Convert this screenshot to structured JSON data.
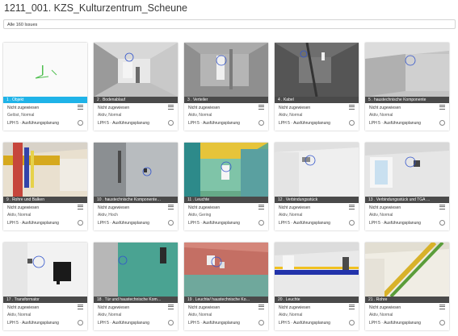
{
  "page": {
    "title": "1211_001. KZS_Kulturzentrum_Scheune",
    "filter_label": "Alle 160 Issues"
  },
  "issues": [
    {
      "label": "1 . Objekt",
      "assignee": "Nicht zugewiesen",
      "status": "Gelöst, Normal",
      "phase": "LPH 5 · Ausführungsplanung",
      "active": true,
      "thumb": "white-green"
    },
    {
      "label": "2 . Bodenablauf",
      "assignee": "Nicht zugewiesen",
      "status": "Aktiv, Normal",
      "phase": "LPH 5 · Ausführungsplanung",
      "active": false,
      "thumb": "corridor"
    },
    {
      "label": "3 . Verteiler",
      "assignee": "Nicht zugewiesen",
      "status": "Aktiv, Normal",
      "phase": "LPH 5 · Ausführungsplanung",
      "active": false,
      "thumb": "grey-room"
    },
    {
      "label": "4 . Kabel",
      "assignee": "Nicht zugewiesen",
      "status": "Aktiv, Normal",
      "phase": "LPH 5 · Ausführungsplanung",
      "active": false,
      "thumb": "dark-room"
    },
    {
      "label": "5 . haustechnische Komponente",
      "assignee": "Nicht zugewiesen",
      "status": "Aktiv, Normal",
      "phase": "LPH 5 · Ausführungsplanung",
      "active": false,
      "thumb": "grey-corner"
    },
    {
      "label": "9 . Rohre und Balken",
      "assignee": "Nicht zugewiesen",
      "status": "Aktiv, Normal",
      "phase": "LPH 5 · Ausführungsplanung",
      "active": false,
      "thumb": "red-yellow"
    },
    {
      "label": "10 . haustechnische Komponente…",
      "assignee": "Nicht zugewiesen",
      "status": "Aktiv, Hoch",
      "phase": "LPH 5 · Ausführungsplanung",
      "active": false,
      "thumb": "grey-wall"
    },
    {
      "label": "11 . Leuchte",
      "assignee": "Nicht zugewiesen",
      "status": "Aktiv, Gering",
      "phase": "LPH 5 · Ausführungsplanung",
      "active": false,
      "thumb": "colorful"
    },
    {
      "label": "12 . Verbindungsstück",
      "assignee": "Nicht zugewiesen",
      "status": "Aktiv, Normal",
      "phase": "LPH 5 · Ausführungsplanung",
      "active": false,
      "thumb": "white-wall"
    },
    {
      "label": "13 . Verbindungsstück und TGA …",
      "assignee": "Nicht zugewiesen",
      "status": "Aktiv, Normal",
      "phase": "LPH 5 · Ausführungsplanung",
      "active": false,
      "thumb": "window-room"
    },
    {
      "label": "17 . Transformator",
      "assignee": "Nicht zugewiesen",
      "status": "Aktiv, Normal",
      "phase": "LPH 5 · Ausführungsplanung",
      "active": false,
      "thumb": "transformer"
    },
    {
      "label": "18 . Tür und haustechnische Kom…",
      "assignee": "Nicht zugewiesen",
      "status": "Aktiv, Normal",
      "phase": "LPH 5 · Ausführungsplanung",
      "active": false,
      "thumb": "teal-door"
    },
    {
      "label": "19 . Leuchte/ haustechnische Ko…",
      "assignee": "Nicht zugewiesen",
      "status": "Aktiv, Normal",
      "phase": "LPH 5 · Ausführungsplanung",
      "active": false,
      "thumb": "pink-wall"
    },
    {
      "label": "20 . Leuchte",
      "assignee": "Nicht zugewiesen",
      "status": "Aktiv, Normal",
      "phase": "LPH 5 · Ausführungsplanung",
      "active": false,
      "thumb": "blue-beam"
    },
    {
      "label": "21 . Rohre",
      "assignee": "Nicht zugewiesen",
      "status": "Aktiv, Normal",
      "phase": "LPH 5 · Ausführungsplanung",
      "active": false,
      "thumb": "pipes-green"
    }
  ]
}
